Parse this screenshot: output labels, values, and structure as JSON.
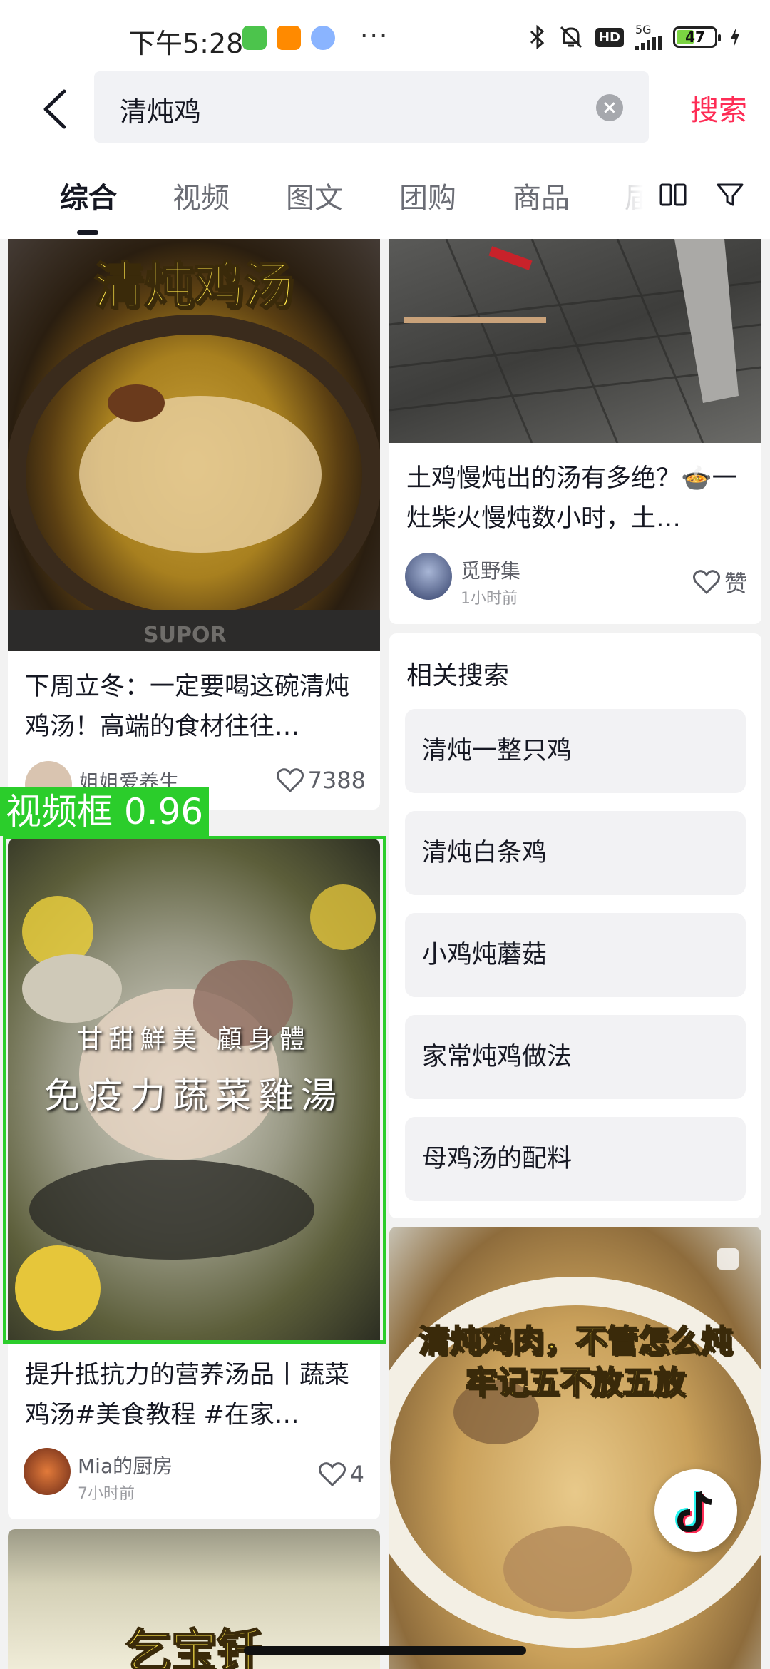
{
  "status_bar": {
    "time": "下午5:28",
    "dots": "···",
    "hd": "HD",
    "network": "5G",
    "battery": "47"
  },
  "search": {
    "query": "清炖鸡",
    "clear": "×",
    "submit": "搜索"
  },
  "tabs": [
    {
      "label": "综合",
      "active": true
    },
    {
      "label": "视频",
      "active": false
    },
    {
      "label": "图文",
      "active": false
    },
    {
      "label": "团购",
      "active": false
    },
    {
      "label": "商品",
      "active": false
    },
    {
      "label": "届",
      "active": false
    }
  ],
  "feed": {
    "card1": {
      "overlay": "清炖鸡汤",
      "title": "下周立冬：一定要喝这碗清炖鸡汤！高端的食材往往…",
      "author": "姐姐爱养生",
      "likes": "7388",
      "watermark": "SUPOR"
    },
    "card2": {
      "title": "土鸡慢炖出的汤有多绝？🍲一灶柴火慢炖数小时，土…",
      "author": "觅野集",
      "time": "1小时前",
      "likes": "赞"
    },
    "card3": {
      "overlay_line1": "甘甜鮮美 顧身體",
      "overlay_line2": "免疫力蔬菜雞湯",
      "title": "提升抵抗力的营养汤品丨蔬菜鸡汤#美食教程 #在家…",
      "author": "Mia的厨房",
      "time": "7小时前",
      "likes": "4"
    },
    "card4": {
      "overlay_line1": "清炖鸡肉，不管怎么炖",
      "overlay_line2": "牢记五不放五放"
    },
    "card5": {
      "overlay": "乞宝钎"
    }
  },
  "related": {
    "title": "相关搜索",
    "items": [
      "清炖一整只鸡",
      "清炖白条鸡",
      "小鸡炖蘑菇",
      "家常炖鸡做法",
      "母鸡汤的配料"
    ]
  },
  "detection": {
    "label": "视频框 0.96"
  }
}
